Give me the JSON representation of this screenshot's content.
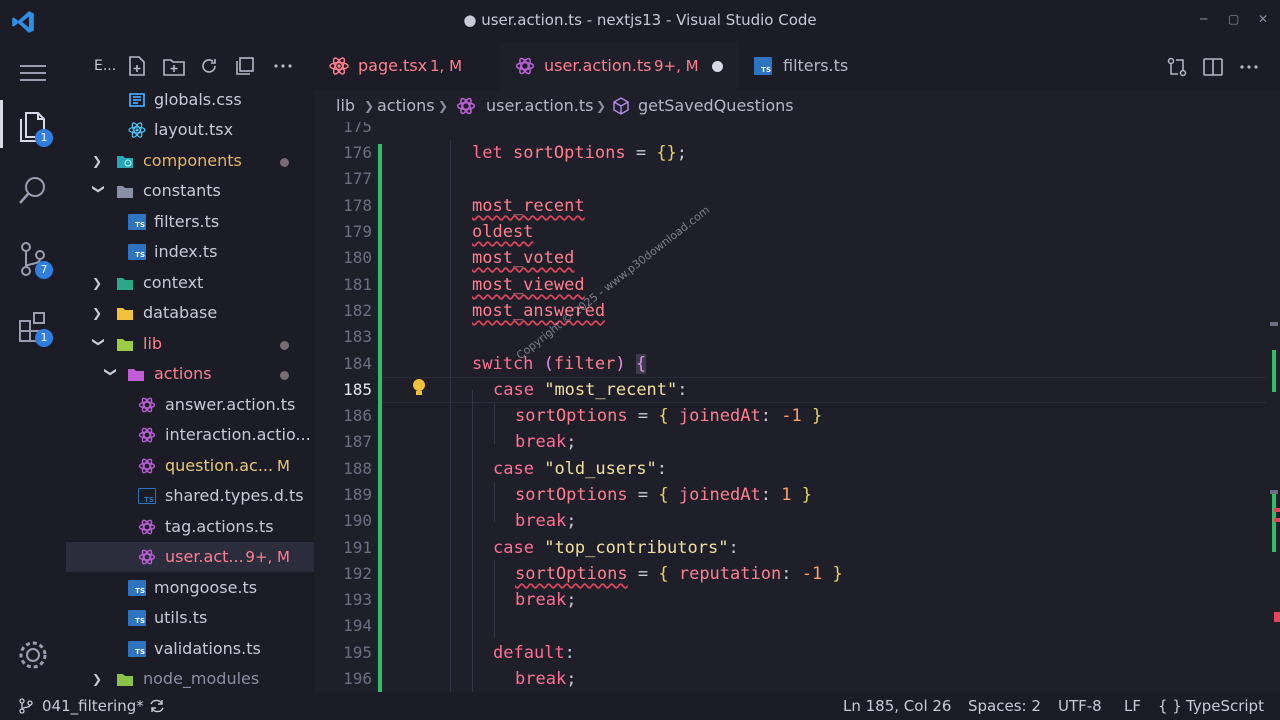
{
  "window": {
    "title": "● user.action.ts - nextjs13 - Visual Studio Code",
    "controls": [
      "─",
      "▢",
      "✕"
    ]
  },
  "activity": {
    "explorer_badge": "1",
    "scm_badge": "7",
    "extensions_badge": "1"
  },
  "sidebar": {
    "header_label": "E...",
    "items": [
      {
        "label": "globals.css"
      },
      {
        "label": "layout.tsx"
      },
      {
        "label": "components"
      },
      {
        "label": "constants"
      },
      {
        "label": "filters.ts"
      },
      {
        "label": "index.ts"
      },
      {
        "label": "context"
      },
      {
        "label": "database"
      },
      {
        "label": "lib"
      },
      {
        "label": "actions"
      },
      {
        "label": "answer.action.ts"
      },
      {
        "label": "interaction.actio..."
      },
      {
        "label": "question.ac...",
        "mark": "M"
      },
      {
        "label": "shared.types.d.ts"
      },
      {
        "label": "tag.actions.ts"
      },
      {
        "label": "user.act...",
        "mark": "9+, M"
      },
      {
        "label": "mongoose.ts"
      },
      {
        "label": "utils.ts"
      },
      {
        "label": "validations.ts"
      },
      {
        "label": "node_modules"
      }
    ]
  },
  "tabs": [
    {
      "label": "page.tsx",
      "mark": "1, M"
    },
    {
      "label": "user.action.ts",
      "mark": "9+, M"
    },
    {
      "label": "filters.ts"
    }
  ],
  "breadcrumb": {
    "parts": [
      "lib",
      "actions",
      "user.action.ts",
      "getSavedQuestions"
    ]
  },
  "editor": {
    "line_numbers": [
      "175",
      "176",
      "177",
      "178",
      "179",
      "180",
      "181",
      "182",
      "183",
      "184",
      "185",
      "186",
      "187",
      "188",
      "189",
      "190",
      "191",
      "192",
      "193",
      "194",
      "195",
      "196"
    ],
    "watermark": "Copyright © 2025 - www.p30download.com"
  },
  "status": {
    "branch": "041_filtering*",
    "position": "Ln 185, Col 26",
    "spaces": "Spaces: 2",
    "encoding": "UTF-8",
    "eol": "LF",
    "language_braces": "{ }",
    "language": "TypeScript"
  }
}
